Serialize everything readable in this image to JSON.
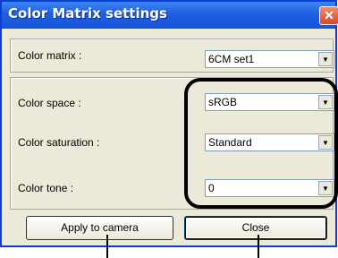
{
  "window": {
    "title": "Color Matrix settings",
    "close_glyph": "✕"
  },
  "fields": [
    {
      "label": "Color matrix :",
      "value": "6CM set1"
    },
    {
      "label": "Color space :",
      "value": "sRGB"
    },
    {
      "label": "Color saturation :",
      "value": "Standard"
    },
    {
      "label": "Color tone :",
      "value": "0"
    }
  ],
  "buttons": {
    "apply_label": "Apply to camera",
    "close_label": "Close"
  },
  "icons": {
    "dropdown": "chevron-down-icon",
    "close": "close-icon"
  },
  "colors": {
    "titlebar": "#1f5fe0",
    "dialog_bg": "#ece9d8",
    "highlight": "#000000"
  }
}
